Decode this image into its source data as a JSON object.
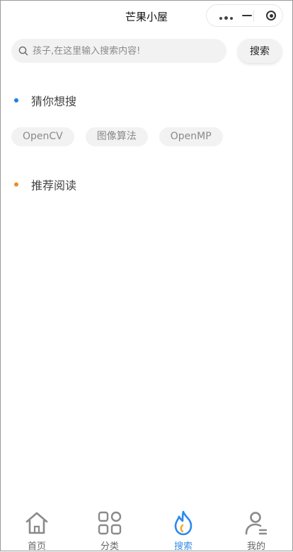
{
  "app": {
    "title": "芒果小屋"
  },
  "capsule": {
    "more_icon": "more-dots-icon",
    "minimize_icon": "minimize-icon",
    "close_icon": "target-icon"
  },
  "search": {
    "placeholder": "孩子,在这里输入搜索内容!",
    "value": "",
    "button_label": "搜索"
  },
  "sections": {
    "guess": {
      "title": "猜你想搜",
      "dot_color": "#1e7fe6"
    },
    "recommend": {
      "title": "推荐阅读",
      "dot_color": "#f08a24"
    }
  },
  "hot_tags": [
    "OpenCV",
    "图像算法",
    "OpenMP"
  ],
  "tabbar": {
    "active_color": "#3a8ee6",
    "items": [
      {
        "label": "首页",
        "icon": "home-icon"
      },
      {
        "label": "分类",
        "icon": "category-grid-icon"
      },
      {
        "label": "搜索",
        "icon": "flame-icon",
        "active": true
      },
      {
        "label": "我的",
        "icon": "user-icon"
      }
    ]
  }
}
